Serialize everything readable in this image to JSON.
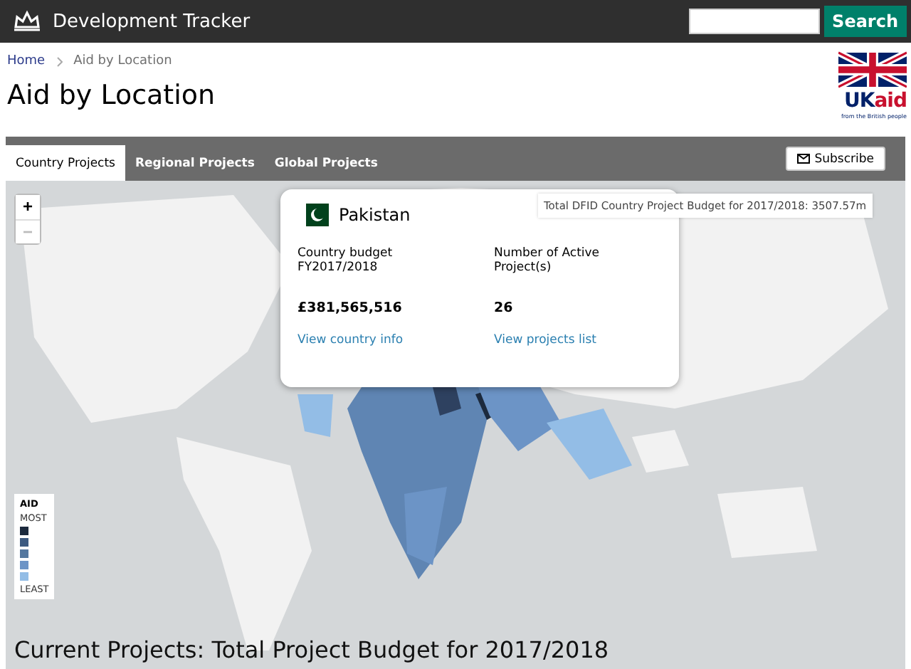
{
  "header": {
    "title": "Development Tracker",
    "search": {
      "button": "Search"
    }
  },
  "breadcrumb": [
    {
      "label": "Home",
      "kind": "link"
    },
    {
      "label": "Aid by Location",
      "kind": "current"
    }
  ],
  "page_title": "Aid by Location",
  "logo": {
    "uk": "UK",
    "aid": "aid",
    "tagline": "from the British people"
  },
  "tabs": [
    {
      "label": "Country Projects",
      "selected": true
    },
    {
      "label": "Regional Projects",
      "selected": false
    },
    {
      "label": "Global Projects",
      "selected": false
    }
  ],
  "subscribe": "Subscribe",
  "map": {
    "kind": "picture",
    "zoom_in": "+",
    "zoom_out": "−",
    "total": "Total DFID Country Project Budget for 2017/2018: 3507.57m",
    "popup": {
      "country": "Pakistan",
      "stats": [
        {
          "label": "Country budget FY2017/2018",
          "value": "£381,565,516",
          "link": "View country info"
        },
        {
          "label": "Number of Active Project(s)",
          "value": "26",
          "link": "View projects list"
        }
      ]
    },
    "legend": {
      "title": "AID",
      "top": "MOST",
      "bottom": "LEAST",
      "levels": [
        {
          "color": "#1c2a3d"
        },
        {
          "color": "#3d5a80"
        },
        {
          "color": "#55789f"
        },
        {
          "color": "#6c94c6"
        },
        {
          "color": "#93bde6"
        }
      ]
    },
    "caption": "Current Projects: Total Project Budget for 2017/2018"
  }
}
